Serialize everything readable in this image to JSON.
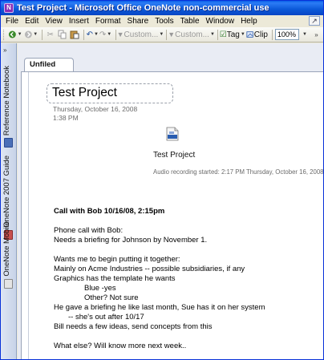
{
  "window": {
    "title": "Test Project - Microsoft Office OneNote non-commercial use",
    "icon": "onenote-app-icon"
  },
  "menu": {
    "items": [
      {
        "label": "File",
        "name": "menu-file"
      },
      {
        "label": "Edit",
        "name": "menu-edit"
      },
      {
        "label": "View",
        "name": "menu-view"
      },
      {
        "label": "Insert",
        "name": "menu-insert"
      },
      {
        "label": "Format",
        "name": "menu-format"
      },
      {
        "label": "Share",
        "name": "menu-share"
      },
      {
        "label": "Tools",
        "name": "menu-tools"
      },
      {
        "label": "Table",
        "name": "menu-table"
      },
      {
        "label": "Window",
        "name": "menu-window"
      },
      {
        "label": "Help",
        "name": "menu-help"
      }
    ]
  },
  "toolbar": {
    "custom_label_1": "Custom...",
    "custom_label_2": "Custom...",
    "tag_label": "Tag",
    "clip_label": "Clip",
    "zoom_value": "100%"
  },
  "rail": {
    "toggle_label": "»",
    "notebooks": [
      {
        "label": "Reference Notebook",
        "color": "#4a6fb8"
      },
      {
        "label": "OneNote 2007 Guide",
        "color": "#c8504e"
      },
      {
        "label": "OneNote Mobile",
        "color": "#d9d9d9"
      }
    ]
  },
  "section": {
    "tab_label": "Unfiled Notes"
  },
  "page": {
    "title": "Test Project",
    "date": "Thursday, October 16, 2008",
    "time": "1:38 PM",
    "audio_file_title": "Test Project",
    "audio_caption": "Audio recording started: 2:17 PM Thursday, October 16, 2008",
    "notes": [
      {
        "text": "Call with Bob 10/16/08,  2:15pm",
        "bold": true,
        "indent": 0
      },
      {
        "text": "",
        "bold": false,
        "indent": 0
      },
      {
        "text": "Phone call with Bob:",
        "bold": false,
        "indent": 0
      },
      {
        "text": "Needs a briefing for Johnson by November 1.",
        "bold": false,
        "indent": 0
      },
      {
        "text": "",
        "bold": false,
        "indent": 0
      },
      {
        "text": "Wants me to begin putting it together:",
        "bold": false,
        "indent": 0
      },
      {
        "text": "Mainly on Acme Industries -- possible subsidiaries, if any",
        "bold": false,
        "indent": 0
      },
      {
        "text": "Graphics has the template he wants",
        "bold": false,
        "indent": 0
      },
      {
        "text": "Blue -yes",
        "bold": false,
        "indent": 2
      },
      {
        "text": "Other? Not sure",
        "bold": false,
        "indent": 2
      },
      {
        "text": "He gave a briefing he like last month, Sue has it on her system",
        "bold": false,
        "indent": 0
      },
      {
        "text": "-- she's out after 10/17",
        "bold": false,
        "indent": 1
      },
      {
        "text": "Bill needs a few ideas, send concepts from this",
        "bold": false,
        "indent": 0
      },
      {
        "text": "",
        "bold": false,
        "indent": 0
      },
      {
        "text": "What else?  Will know more next week..",
        "bold": false,
        "indent": 0
      }
    ]
  }
}
